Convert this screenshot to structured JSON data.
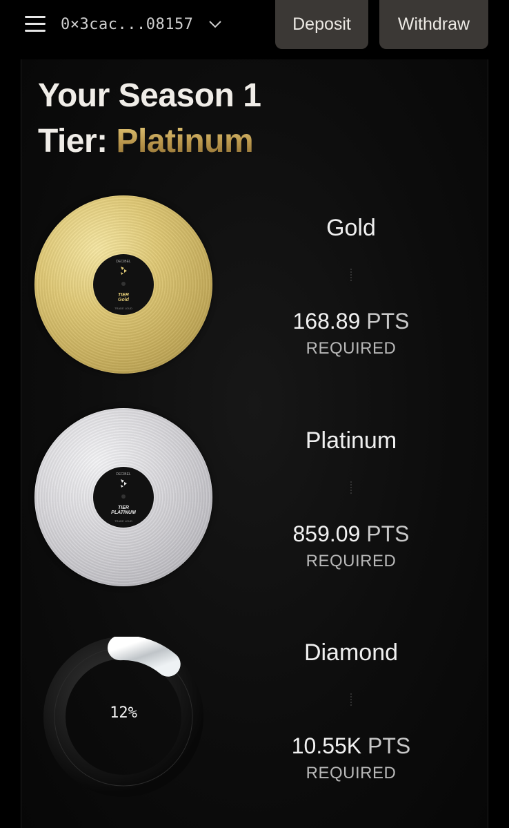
{
  "header": {
    "wallet_address": "0×3cac...08157",
    "deposit_label": "Deposit",
    "withdraw_label": "Withdraw"
  },
  "title": {
    "line1": "Your Season 1",
    "line2_prefix": "Tier: ",
    "current_tier": "Platinum"
  },
  "tiers": [
    {
      "name": "Gold",
      "points": "168.89",
      "unit": "PTS",
      "required_label": "REQUIRED",
      "disc_label": {
        "brand": "DECIBEL",
        "tier_word": "TIER",
        "tier_name": "Gold",
        "footer": "TRADE LOUD"
      }
    },
    {
      "name": "Platinum",
      "points": "859.09",
      "unit": "PTS",
      "required_label": "REQUIRED",
      "disc_label": {
        "brand": "DECIBEL",
        "tier_word": "TIER",
        "tier_name": "PLATINUM",
        "footer": "TRADE LOUD"
      }
    },
    {
      "name": "Diamond",
      "points": "10.55K",
      "unit": "PTS",
      "required_label": "REQUIRED",
      "progress_label": "12%",
      "progress": 0.12
    }
  ],
  "colors": {
    "accent_gold": "#d4b463",
    "button_bg": "#3b3835",
    "background": "#000000"
  },
  "icons": [
    "menu-icon",
    "chevron-down-icon",
    "tier-logo-icon"
  ]
}
